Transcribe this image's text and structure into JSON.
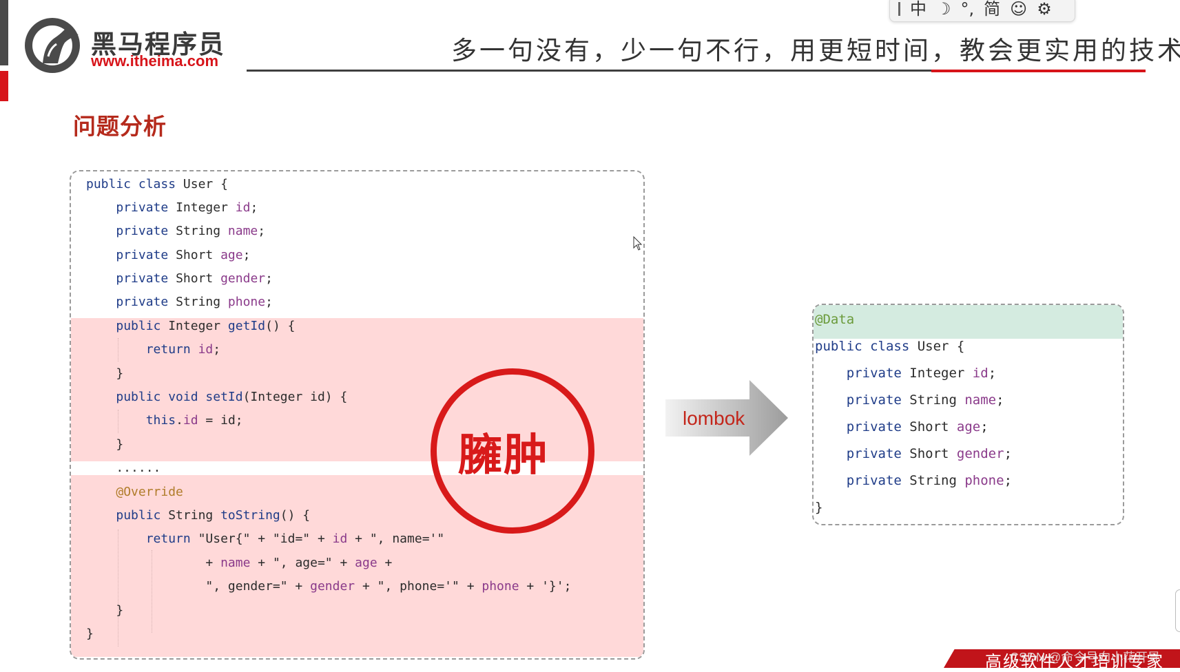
{
  "header": {
    "brand_name": "黑马程序员",
    "brand_url": "www.itheima.com",
    "slogan": "多一句没有，少一句不行，用更短时间，教会更实用的技术!"
  },
  "ime_toolbar": {
    "items": [
      "中",
      "☽",
      "°,",
      "简",
      "☺",
      "⚙"
    ]
  },
  "section_title": "问题分析",
  "left_code": {
    "lines": [
      "public class User {",
      "    private Integer id;",
      "    private String name;",
      "    private Short age;",
      "    private Short gender;",
      "    private String phone;",
      "    public Integer getId() {",
      "        return id;",
      "    }",
      "    public void setId(Integer id) {",
      "        this.id = id;",
      "    }",
      "    ......",
      "    @Override",
      "    public String toString() {",
      "        return \"User{\" + \"id=\" + id + \", name='\"",
      "                + name + \", age=\" + age +",
      "                \", gender=\" + gender + \", phone='\" + phone + '}';",
      "    }",
      "}"
    ]
  },
  "stamp_text": "臃肿",
  "arrow_label": "lombok",
  "right_code": {
    "annotation": "@Data",
    "lines": [
      "public class User {",
      "    private Integer id;",
      "    private String name;",
      "    private Short age;",
      "    private Short gender;",
      "    private String phone;",
      "}"
    ]
  },
  "footer": {
    "banner_text": "高级软件人才培训专家",
    "watermark": "CSDN @命令号向小花开导"
  },
  "colors": {
    "brand_red": "#d7141a",
    "keyword": "#1f3c88",
    "field": "#8a3a8a",
    "highlight_red": "#ffd9d9",
    "highlight_green": "#d4ebe0"
  }
}
